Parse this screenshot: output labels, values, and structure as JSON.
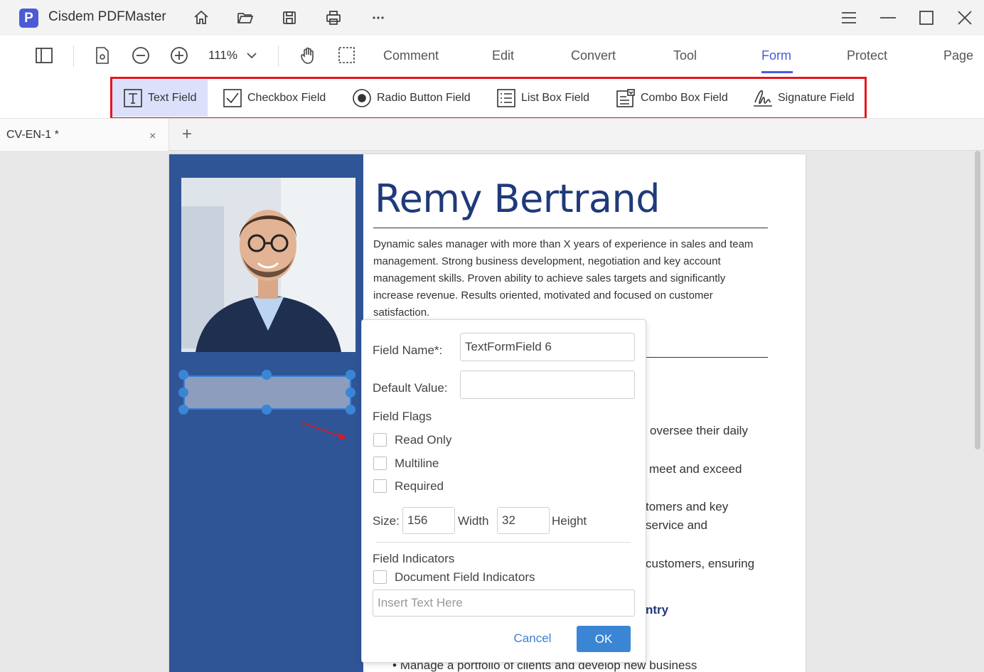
{
  "app": {
    "logo_letter": "P",
    "title": "Cisdem PDFMaster"
  },
  "toolbar": {
    "zoom": "111%",
    "tabs": [
      {
        "label": "Comment"
      },
      {
        "label": "Edit"
      },
      {
        "label": "Convert"
      },
      {
        "label": "Tool"
      },
      {
        "label": "Form"
      },
      {
        "label": "Protect"
      },
      {
        "label": "Page"
      }
    ],
    "active_tab": "Form"
  },
  "form_tools": [
    {
      "label": "Text Field"
    },
    {
      "label": "Checkbox Field"
    },
    {
      "label": "Radio Button Field"
    },
    {
      "label": "List Box Field"
    },
    {
      "label": "Combo Box Field"
    },
    {
      "label": "Signature Field"
    }
  ],
  "doc_tab": {
    "label": "CV-EN-1 *",
    "close": "×",
    "add": "+"
  },
  "document": {
    "name": "Remy Bertrand",
    "bio": "Dynamic sales manager with more than X years of experience in sales and team management. Strong business development, negotiation and key account management skills. Proven ability to achieve sales targets and significantly increase revenue. Results oriented, motivated and focused on customer satisfaction.",
    "fragments": [
      "oversee their daily",
      "meet and exceed",
      "tomers and key",
      "service and",
      "customers, ensuring",
      "ntry",
      "Manage a portfolio of clients and develop new business"
    ]
  },
  "dialog": {
    "field_name_label": "Field Name*:",
    "field_name_value": "TextFormField 6",
    "default_value_label": "Default Value:",
    "default_value": "",
    "field_flags_label": "Field Flags",
    "flags": [
      {
        "label": "Read Only",
        "checked": false
      },
      {
        "label": "Multiline",
        "checked": false
      },
      {
        "label": "Required",
        "checked": false
      }
    ],
    "size_label": "Size:",
    "width_value": "156",
    "width_label": "Width",
    "height_value": "32",
    "height_label": "Height",
    "indicators_label": "Field Indicators",
    "doc_indicators_label": "Document Field Indicators",
    "insert_placeholder": "Insert Text Here",
    "cancel_label": "Cancel",
    "ok_label": "OK"
  },
  "colors": {
    "accent": "#4b5bd6",
    "highlight_outline": "#e8141c",
    "sidebar_blue": "#2f5597",
    "name_color": "#1f3a7a",
    "ok_button": "#3a86d4"
  }
}
